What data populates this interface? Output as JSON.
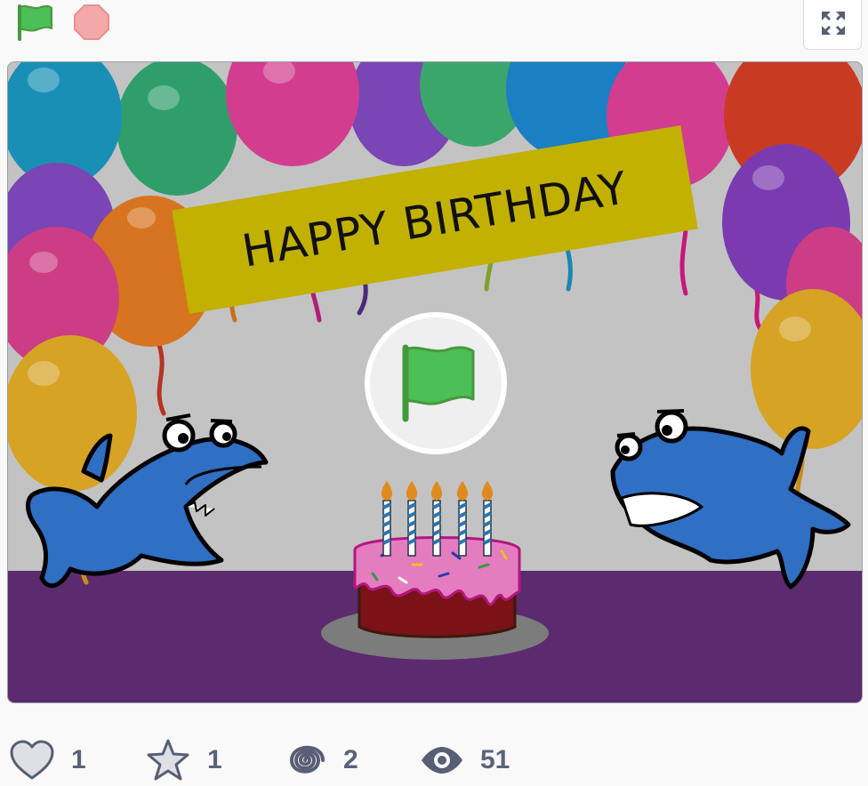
{
  "controls": {
    "green_flag_icon": "green-flag-icon",
    "stop_icon": "stop-sign-icon",
    "fullscreen_icon": "fullscreen-icon"
  },
  "stage": {
    "banner_text": "HAPPY BIRTHDAY",
    "play_icon": "green-flag-icon",
    "colors": {
      "background": "#c3c3c3",
      "floor": "#5c2a6e",
      "banner": "#c2b100",
      "shark": "#2f6fc4",
      "flag": "#4cbf56"
    }
  },
  "stats": {
    "loves": "1",
    "favorites": "1",
    "remixes": "2",
    "views": "51"
  }
}
